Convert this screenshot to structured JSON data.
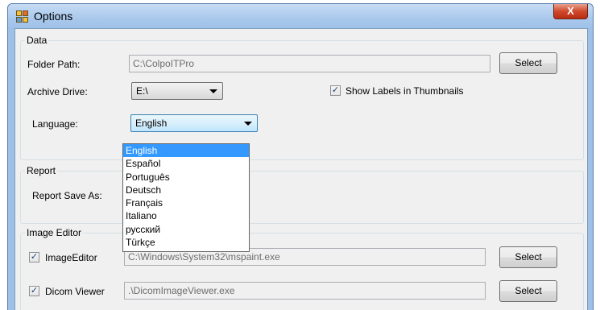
{
  "window": {
    "title": "Options",
    "close_glyph": "X"
  },
  "data_group": {
    "legend": "Data",
    "folder_path_label": "Folder Path:",
    "folder_path_value": "C:\\ColpoITPro",
    "select_label": "Select",
    "archive_drive_label": "Archive Drive:",
    "archive_drive_value": "E:\\",
    "show_labels_checked": true,
    "show_labels_label": "Show Labels in Thumbnails",
    "language_label": "Language:",
    "language_value": "English"
  },
  "language_dropdown": {
    "items": [
      "English",
      "Español",
      "Português",
      "Deutsch",
      "Français",
      "Italiano",
      "русский",
      "Türkçe"
    ],
    "selected_index": 0
  },
  "report_group": {
    "legend": "Report",
    "save_as_label": "Report Save As:"
  },
  "image_editor_group": {
    "legend": "Image Editor",
    "image_editor_checked": true,
    "image_editor_label": "ImageEditor",
    "image_editor_path": "C:\\Windows\\System32\\mspaint.exe",
    "image_editor_select_label": "Select",
    "dicom_viewer_checked": true,
    "dicom_viewer_label": "Dicom Viewer",
    "dicom_viewer_path": ".\\DicomImageViewer.exe",
    "dicom_viewer_select_label": "Select"
  },
  "colors": {
    "window_frame": "#9ec0e6",
    "dialog_background": "#f0f0f0",
    "selection_highlight": "#3399ff",
    "close_button": "#c9452a"
  },
  "icons": {
    "app": "options-window-icon",
    "close": "close-icon",
    "combo_arrow": "chevron-down-icon",
    "check": "checkmark-icon"
  }
}
